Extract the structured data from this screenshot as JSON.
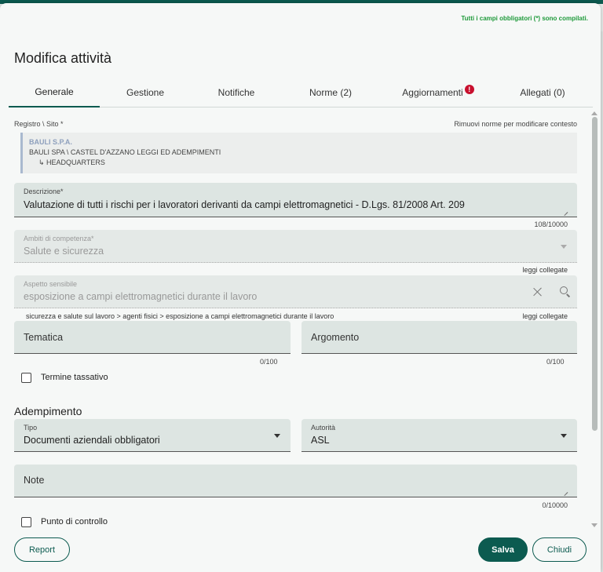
{
  "dialog": {
    "title": "Modifica attività",
    "status_message": "Tutti i campi obbligatori (*) sono compilati."
  },
  "tabs": [
    {
      "label": "Generale",
      "active": true
    },
    {
      "label": "Gestione"
    },
    {
      "label": "Notifiche"
    },
    {
      "label": "Norme (2)"
    },
    {
      "label": "Aggiornamenti",
      "badge": "!"
    },
    {
      "label": "Allegati (0)"
    }
  ],
  "context": {
    "label": "Registro \\ Sito *",
    "remove_hint": "Rimuovi norme per modificare contesto",
    "company": "BAULI S.P.A.",
    "path": "BAULI SPA \\ CASTEL D'AZZANO LEGGI ED ADEMPIMENTI",
    "site": "↳ HEADQUARTERS"
  },
  "descrizione": {
    "label": "Descrizione*",
    "value": "Valutazione di tutti i rischi per i lavoratori derivanti da campi elettromagnetici - D.Lgs. 81/2008 Art. 209",
    "counter": "108/10000"
  },
  "ambiti": {
    "label": "Ambiti di competenza*",
    "value": "Salute e sicurezza",
    "link": "leggi collegate"
  },
  "aspetto": {
    "label": "Aspetto sensibile",
    "value": "esposizione a campi elettromagnetici durante il lavoro",
    "breadcrumb": "sicurezza e salute sul lavoro > agenti fisici > esposizione a campi elettromagnetici durante il lavoro",
    "link": "leggi collegate"
  },
  "tematica": {
    "label": "Tematica",
    "counter": "0/100"
  },
  "argomento": {
    "label": "Argomento",
    "counter": "0/100"
  },
  "termine": {
    "label": "Termine tassativo",
    "checked": false
  },
  "adempimento": {
    "title": "Adempimento",
    "tipo": {
      "label": "Tipo",
      "value": "Documenti aziendali obbligatori"
    },
    "autorita": {
      "label": "Autorità",
      "value": "ASL"
    }
  },
  "note": {
    "label": "Note",
    "counter": "0/10000"
  },
  "punto": {
    "label": "Punto di controllo",
    "checked": false
  },
  "footer": {
    "report": "Report",
    "salva": "Salva",
    "chiudi": "Chiudi"
  },
  "colors": {
    "primary": "#0c5b50",
    "success_text": "#1f9a3b",
    "badge": "#c8102e"
  }
}
